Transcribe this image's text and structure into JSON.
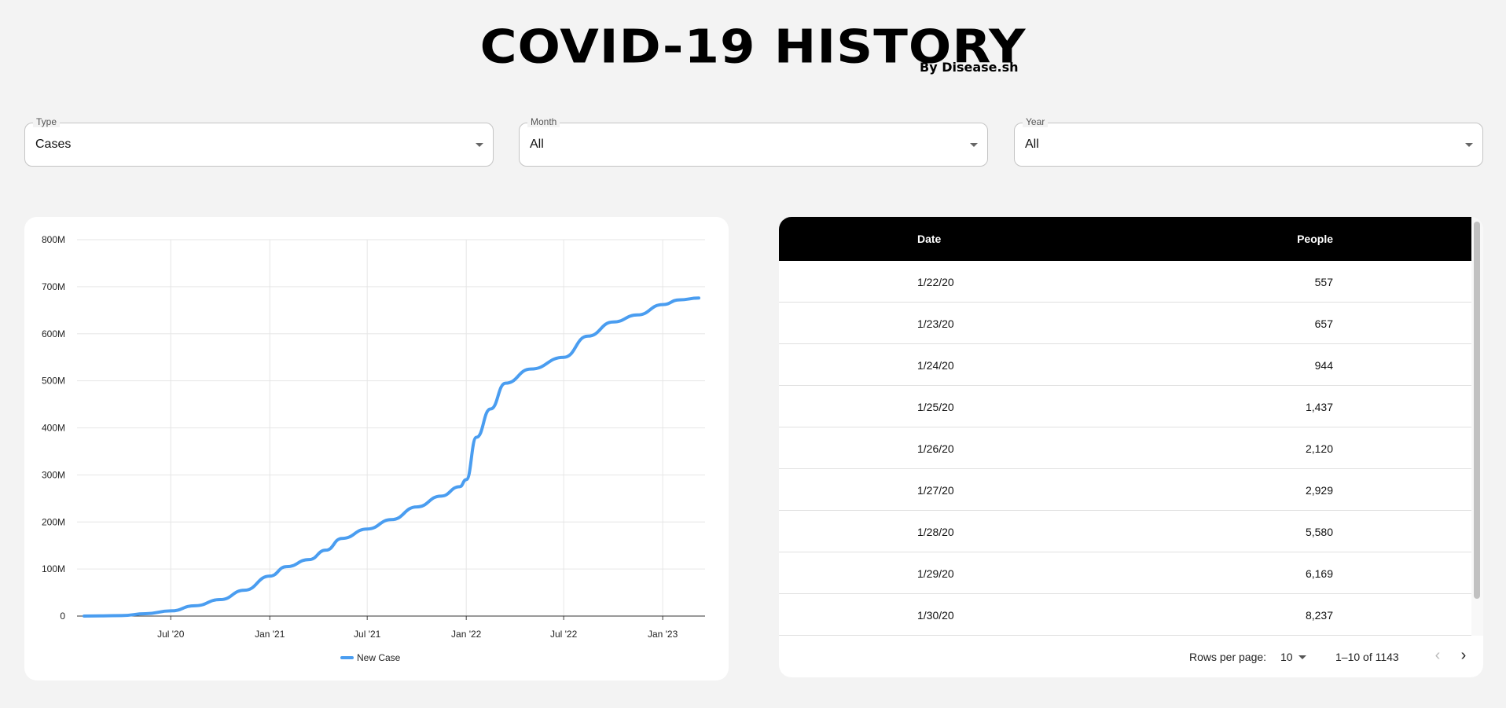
{
  "header": {
    "title": "COVID-19 HISTORY",
    "subtitle": "By Disease.sh"
  },
  "filters": {
    "type": {
      "label": "Type",
      "value": "Cases"
    },
    "month": {
      "label": "Month",
      "value": "All"
    },
    "year": {
      "label": "Year",
      "value": "All"
    }
  },
  "chart_data": {
    "type": "line",
    "title": "",
    "xlabel": "",
    "ylabel": "",
    "x_ticks": [
      "Jul '20",
      "Jan '21",
      "Jul '21",
      "Jan '22",
      "Jul '22",
      "Jan '23"
    ],
    "y_ticks": [
      "0",
      "100M",
      "200M",
      "300M",
      "400M",
      "500M",
      "600M",
      "700M",
      "800M"
    ],
    "ylim": [
      0,
      800000000
    ],
    "xlim": [
      "2020-01-22",
      "2023-03-09"
    ],
    "grid": true,
    "legend": "bottom-center",
    "series": [
      {
        "name": "New Case",
        "color": "#4a9df0",
        "points": [
          [
            "2020-01-22",
            557
          ],
          [
            "2020-04-01",
            1000000
          ],
          [
            "2020-05-15",
            5000000
          ],
          [
            "2020-07-01",
            11000000
          ],
          [
            "2020-08-15",
            22000000
          ],
          [
            "2020-10-01",
            35000000
          ],
          [
            "2020-11-15",
            55000000
          ],
          [
            "2021-01-01",
            85000000
          ],
          [
            "2021-02-01",
            105000000
          ],
          [
            "2021-03-15",
            120000000
          ],
          [
            "2021-04-15",
            140000000
          ],
          [
            "2021-05-15",
            165000000
          ],
          [
            "2021-07-01",
            185000000
          ],
          [
            "2021-08-15",
            205000000
          ],
          [
            "2021-10-01",
            232000000
          ],
          [
            "2021-11-15",
            255000000
          ],
          [
            "2021-12-20",
            275000000
          ],
          [
            "2022-01-01",
            290000000
          ],
          [
            "2022-01-20",
            380000000
          ],
          [
            "2022-02-15",
            440000000
          ],
          [
            "2022-03-15",
            495000000
          ],
          [
            "2022-05-01",
            525000000
          ],
          [
            "2022-07-01",
            550000000
          ],
          [
            "2022-08-15",
            595000000
          ],
          [
            "2022-10-01",
            625000000
          ],
          [
            "2022-11-15",
            640000000
          ],
          [
            "2023-01-01",
            662000000
          ],
          [
            "2023-02-01",
            672000000
          ],
          [
            "2023-03-09",
            676000000
          ]
        ]
      }
    ]
  },
  "table": {
    "columns": [
      "Date",
      "People"
    ],
    "rows": [
      [
        "1/22/20",
        "557"
      ],
      [
        "1/23/20",
        "657"
      ],
      [
        "1/24/20",
        "944"
      ],
      [
        "1/25/20",
        "1,437"
      ],
      [
        "1/26/20",
        "2,120"
      ],
      [
        "1/27/20",
        "2,929"
      ],
      [
        "1/28/20",
        "5,580"
      ],
      [
        "1/29/20",
        "6,169"
      ],
      [
        "1/30/20",
        "8,237"
      ]
    ]
  },
  "pagination": {
    "rows_per_page_label": "Rows per page:",
    "rows_per_page_value": "10",
    "range": "1–10 of 1143",
    "prev_icon": "chevron-left-icon",
    "next_icon": "chevron-right-icon"
  }
}
